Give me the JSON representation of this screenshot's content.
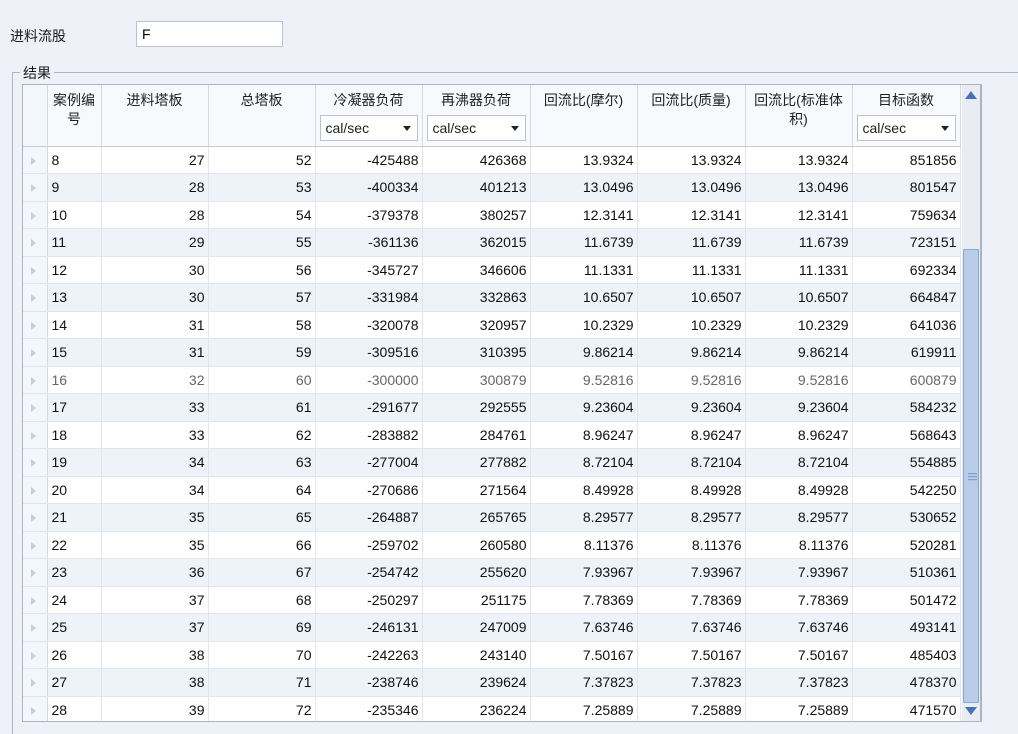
{
  "feed_stream": {
    "label": "进料流股",
    "value": "F"
  },
  "results_group": {
    "title": "结果"
  },
  "columns": [
    {
      "label": "案例编号"
    },
    {
      "label": "进料塔板"
    },
    {
      "label": "总塔板"
    },
    {
      "label": "冷凝器负荷",
      "unit": "cal/sec"
    },
    {
      "label": "再沸器负荷",
      "unit": "cal/sec"
    },
    {
      "label": "回流比(摩尔)"
    },
    {
      "label": "回流比(质量)"
    },
    {
      "label": "回流比(标准体积)"
    },
    {
      "label": "目标函数",
      "unit": "cal/sec"
    }
  ],
  "rows": [
    [
      "8",
      "27",
      "52",
      "-425488",
      "426368",
      "13.9324",
      "13.9324",
      "13.9324",
      "851856"
    ],
    [
      "9",
      "28",
      "53",
      "-400334",
      "401213",
      "13.0496",
      "13.0496",
      "13.0496",
      "801547"
    ],
    [
      "10",
      "28",
      "54",
      "-379378",
      "380257",
      "12.3141",
      "12.3141",
      "12.3141",
      "759634"
    ],
    [
      "11",
      "29",
      "55",
      "-361136",
      "362015",
      "11.6739",
      "11.6739",
      "11.6739",
      "723151"
    ],
    [
      "12",
      "30",
      "56",
      "-345727",
      "346606",
      "11.1331",
      "11.1331",
      "11.1331",
      "692334"
    ],
    [
      "13",
      "30",
      "57",
      "-331984",
      "332863",
      "10.6507",
      "10.6507",
      "10.6507",
      "664847"
    ],
    [
      "14",
      "31",
      "58",
      "-320078",
      "320957",
      "10.2329",
      "10.2329",
      "10.2329",
      "641036"
    ],
    [
      "15",
      "31",
      "59",
      "-309516",
      "310395",
      "9.86214",
      "9.86214",
      "9.86214",
      "619911"
    ],
    [
      "16",
      "32",
      "60",
      "-300000",
      "300879",
      "9.52816",
      "9.52816",
      "9.52816",
      "600879"
    ],
    [
      "17",
      "33",
      "61",
      "-291677",
      "292555",
      "9.23604",
      "9.23604",
      "9.23604",
      "584232"
    ],
    [
      "18",
      "33",
      "62",
      "-283882",
      "284761",
      "8.96247",
      "8.96247",
      "8.96247",
      "568643"
    ],
    [
      "19",
      "34",
      "63",
      "-277004",
      "277882",
      "8.72104",
      "8.72104",
      "8.72104",
      "554885"
    ],
    [
      "20",
      "34",
      "64",
      "-270686",
      "271564",
      "8.49928",
      "8.49928",
      "8.49928",
      "542250"
    ],
    [
      "21",
      "35",
      "65",
      "-264887",
      "265765",
      "8.29577",
      "8.29577",
      "8.29577",
      "530652"
    ],
    [
      "22",
      "35",
      "66",
      "-259702",
      "260580",
      "8.11376",
      "8.11376",
      "8.11376",
      "520281"
    ],
    [
      "23",
      "36",
      "67",
      "-254742",
      "255620",
      "7.93967",
      "7.93967",
      "7.93967",
      "510361"
    ],
    [
      "24",
      "37",
      "68",
      "-250297",
      "251175",
      "7.78369",
      "7.78369",
      "7.78369",
      "501472"
    ],
    [
      "25",
      "37",
      "69",
      "-246131",
      "247009",
      "7.63746",
      "7.63746",
      "7.63746",
      "493141"
    ],
    [
      "26",
      "38",
      "70",
      "-242263",
      "243140",
      "7.50167",
      "7.50167",
      "7.50167",
      "485403"
    ],
    [
      "27",
      "38",
      "71",
      "-238746",
      "239624",
      "7.37823",
      "7.37823",
      "7.37823",
      "478370"
    ],
    [
      "28",
      "39",
      "72",
      "-235346",
      "236224",
      "7.25889",
      "7.25889",
      "7.25889",
      "471570"
    ]
  ],
  "dimmed_row": 8
}
